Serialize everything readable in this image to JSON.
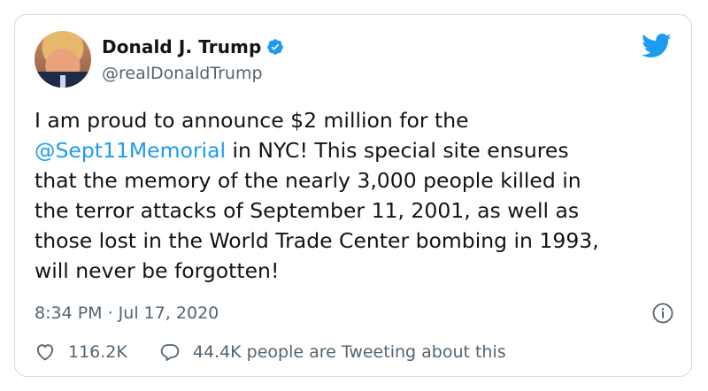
{
  "author": {
    "name": "Donald J. Trump",
    "handle": "@realDonaldTrump",
    "verified": true
  },
  "tweet": {
    "text_before": "I am proud to announce $2 million for the\n",
    "mention": "@Sept11Memorial",
    "text_after": " in NYC! This special site ensures\nthat the memory of the nearly 3,000 people killed in\nthe terror attacks of September 11, 2001, as well as\nthose lost in the World Trade Center bombing in 1993,\nwill never be forgotten!",
    "timestamp": "8:34 PM · Jul 17, 2020"
  },
  "actions": {
    "likes": "116.2K",
    "discussion": "44.4K people are Tweeting about this"
  },
  "icons": {
    "brand": "twitter-bird-icon",
    "verified": "verified-badge-icon",
    "info": "info-icon",
    "like": "heart-icon",
    "reply": "speech-bubble-icon"
  },
  "colors": {
    "accent": "#1d9bf0",
    "text": "#0f1419",
    "secondary": "#536471",
    "border": "#cfd9de"
  }
}
